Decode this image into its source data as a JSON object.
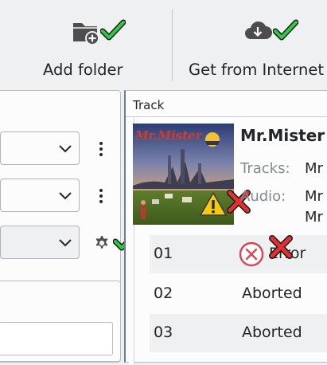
{
  "toolbar": {
    "add_folder_label": "Add folder",
    "get_from_internet_label": "Get from Internet"
  },
  "icons": {
    "add_folder": "folder-add-icon",
    "get_from_internet": "cloud-download-icon",
    "status_ok": "green-check-icon",
    "status_fail": "red-cross-icon",
    "warning": "warning-icon",
    "error": "error-circle-icon"
  },
  "colors": {
    "ok_green": "#2ecc40",
    "fail_red": "#e03030",
    "warning_yellow": "#f6c915",
    "error_red": "#da4453"
  },
  "track_panel": {
    "title": "Track",
    "album_title": "Mr.Mister",
    "tracks_key": "Tracks:",
    "tracks_value": "Mr",
    "audio_key": "Audio:",
    "audio_value_1": "Mr",
    "audio_value_2": "Mr"
  },
  "tracks": [
    {
      "number": "01",
      "status": "Error"
    },
    {
      "number": "02",
      "status": "Aborted"
    },
    {
      "number": "03",
      "status": "Aborted"
    }
  ]
}
